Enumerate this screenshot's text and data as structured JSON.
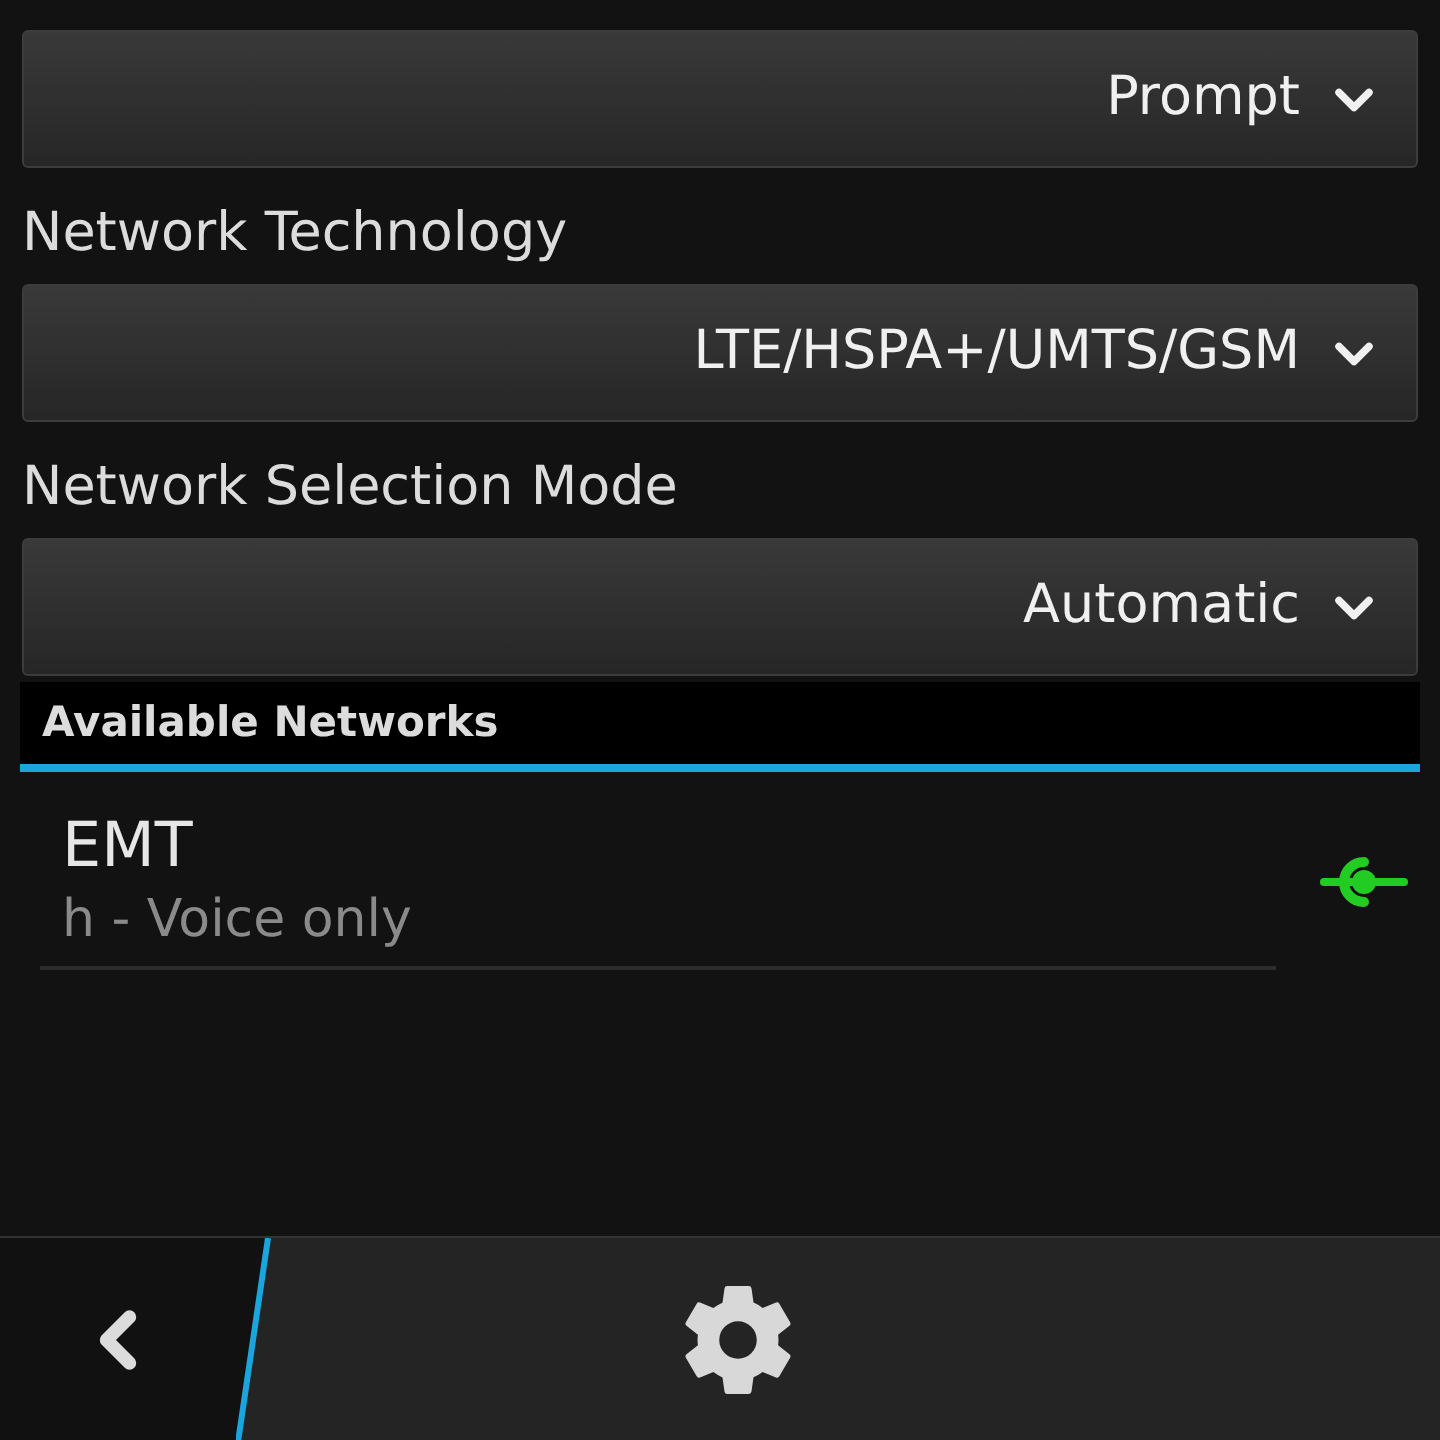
{
  "settings": [
    {
      "kind": "dropdown",
      "value": "Prompt"
    },
    {
      "kind": "heading",
      "text": "Network Technology"
    },
    {
      "kind": "dropdown",
      "value": "LTE/HSPA+/UMTS/GSM"
    },
    {
      "kind": "heading",
      "text": "Network Selection Mode"
    },
    {
      "kind": "dropdown",
      "value": "Automatic"
    }
  ],
  "available_networks": {
    "header": "Available Networks",
    "items": [
      {
        "name": "EMT",
        "detail": "h - Voice only"
      }
    ]
  }
}
